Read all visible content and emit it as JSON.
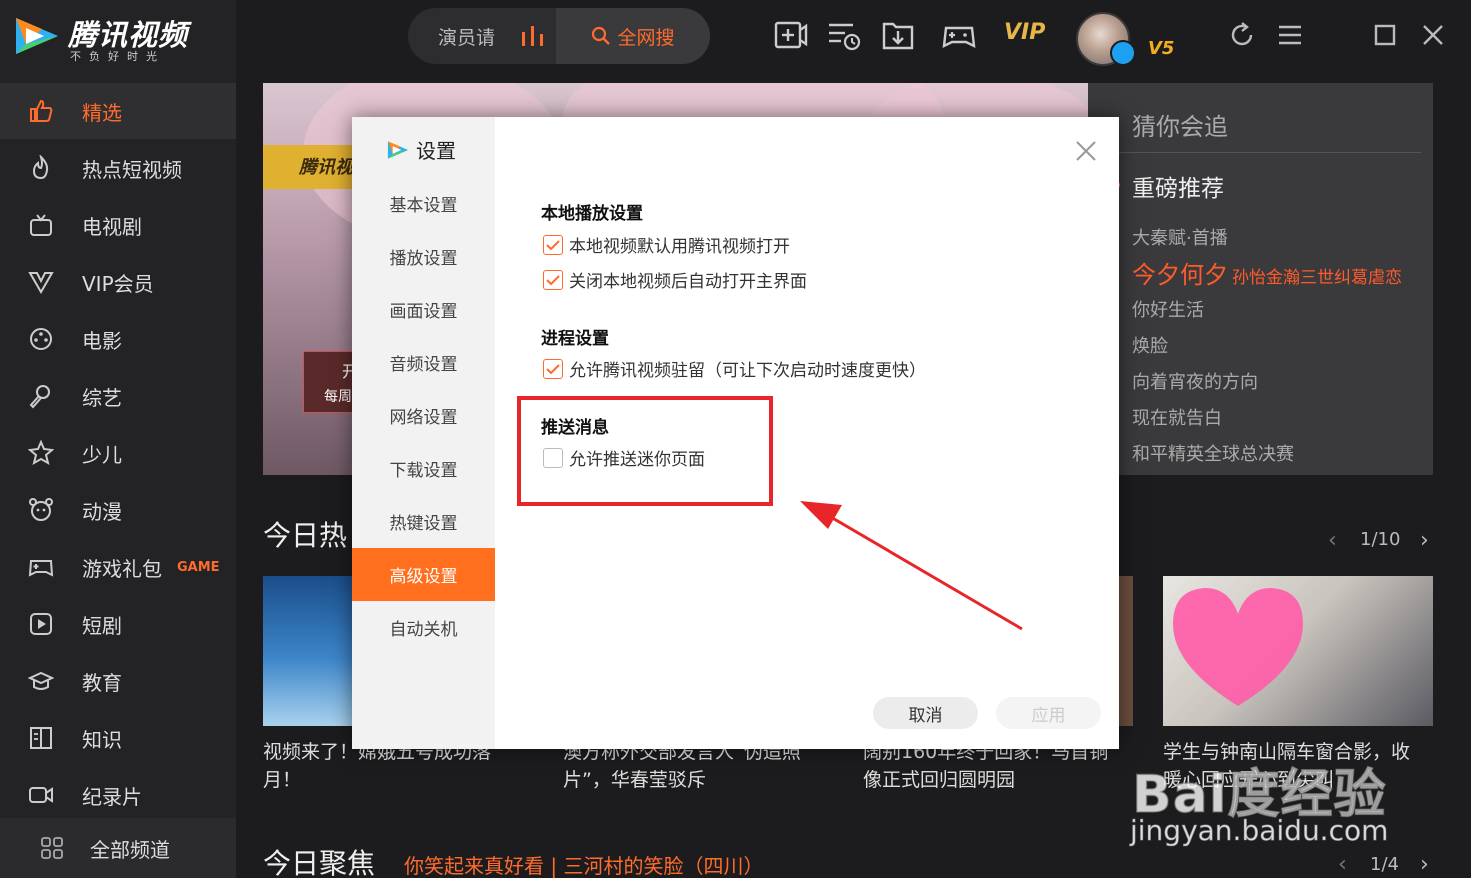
{
  "app": {
    "logo_name": "腾讯视频",
    "logo_slogan": "不负好时光"
  },
  "search": {
    "placeholder_text": "演员请",
    "button_label": "全网搜"
  },
  "header": {
    "vip_label": "VIP",
    "level_badge": "V5"
  },
  "sidebar": {
    "items": [
      {
        "label": "精选",
        "icon": "thumbs-up-icon",
        "active": true
      },
      {
        "label": "热点短视频",
        "icon": "flame-icon"
      },
      {
        "label": "电视剧",
        "icon": "tv-icon"
      },
      {
        "label": "VIP会员",
        "icon": "vip-icon"
      },
      {
        "label": "电影",
        "icon": "film-reel-icon"
      },
      {
        "label": "综艺",
        "icon": "microphone-icon"
      },
      {
        "label": "少儿",
        "icon": "kid-icon"
      },
      {
        "label": "动漫",
        "icon": "bear-face-icon"
      },
      {
        "label": "游戏礼包",
        "icon": "gamepad-icon",
        "tag": "GAME"
      },
      {
        "label": "短剧",
        "icon": "play-square-icon"
      },
      {
        "label": "教育",
        "icon": "grad-cap-icon"
      },
      {
        "label": "知识",
        "icon": "book-icon"
      },
      {
        "label": "纪录片",
        "icon": "camera-icon"
      }
    ],
    "all_channels": "全部频道"
  },
  "guess": {
    "title": "猜你会追",
    "rec_title": "重磅推荐",
    "items": [
      {
        "text": "大秦赋·首播"
      },
      {
        "text": "今夕何夕",
        "sub": "孙怡金瀚三世纠葛虐恋",
        "highlight": true
      },
      {
        "text": "你好生活"
      },
      {
        "text": "焕脸"
      },
      {
        "text": "向着宵夜的方向"
      },
      {
        "text": "现在就告白"
      },
      {
        "text": "和平精英全球总决赛"
      }
    ]
  },
  "today_hot": {
    "title": "今日热",
    "pager": "1/10",
    "cards": [
      {
        "caption": "视频来了！嫦娥五号成功落月！"
      },
      {
        "caption": "澳方称外交部发言人“伪造照片”，华春莹驳斥"
      },
      {
        "caption": "阔别160年终于回家！马首铜像正式回归圆明园"
      },
      {
        "caption": "学生与钟南山隔车窗合影，收暖心回应开心到尖叫"
      }
    ]
  },
  "today_focus": {
    "title": "今日聚焦",
    "subtitle": "你笑起来真好看 | 三河村的笑脸（四川）",
    "pager": "1/4"
  },
  "banner": {
    "badge": "腾讯视",
    "tag_line1": "开",
    "tag_line2": "每周"
  },
  "settings_dialog": {
    "title": "设置",
    "nav": [
      {
        "label": "基本设置"
      },
      {
        "label": "播放设置"
      },
      {
        "label": "画面设置"
      },
      {
        "label": "音频设置"
      },
      {
        "label": "网络设置"
      },
      {
        "label": "下载设置"
      },
      {
        "label": "热键设置"
      },
      {
        "label": "高级设置",
        "active": true
      },
      {
        "label": "自动关机"
      }
    ],
    "groups": [
      {
        "title": "本地播放设置",
        "options": [
          {
            "label": "本地视频默认用腾讯视频打开",
            "checked": true
          },
          {
            "label": "关闭本地视频后自动打开主界面",
            "checked": true
          }
        ]
      },
      {
        "title": "进程设置",
        "options": [
          {
            "label": "允许腾讯视频驻留（可让下次启动时速度更快）",
            "checked": true
          }
        ]
      },
      {
        "title": "推送消息",
        "options": [
          {
            "label": "允许推送迷你页面",
            "checked": false
          }
        ]
      }
    ],
    "cancel_label": "取消",
    "apply_label": "应用"
  },
  "watermark": {
    "logo": "Bai度经验",
    "url": "jingyan.baidu.com"
  },
  "colors": {
    "accent": "#ff6b2c",
    "highlight_box": "#e8262a",
    "sidebar_bg": "#232326"
  }
}
